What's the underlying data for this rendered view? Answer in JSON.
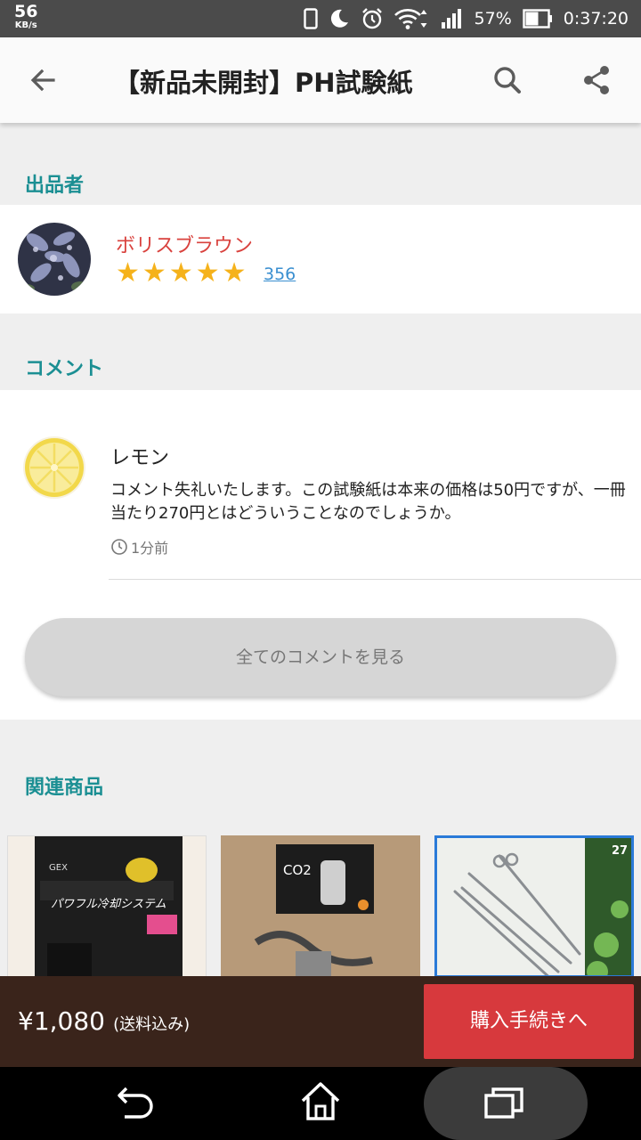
{
  "status_bar": {
    "speed_value": "56",
    "speed_unit": "KB/s",
    "battery": "57%",
    "time": "0:37:20",
    "icons": [
      "phone-icon",
      "moon-icon",
      "alarm-icon",
      "wifi-icon",
      "signal-icon",
      "battery-icon"
    ]
  },
  "appbar": {
    "title": "【新品未開封】PH試験紙",
    "icons": [
      "back-arrow-icon",
      "search-icon",
      "share-icon"
    ]
  },
  "seller_section": {
    "heading": "出品者",
    "name": "ボリスブラウン",
    "stars": "★★★★★",
    "rating_out_of_5": 5,
    "rating_count": "356"
  },
  "comment_section": {
    "heading": "コメント",
    "comment": {
      "user": "レモン",
      "text": "コメント失礼いたします。この試験紙は本来の価格は50円ですが、一冊当たり270円とはどういうことなのでしょうか。",
      "time": "1分前"
    },
    "all_button": "全てのコメントを見る"
  },
  "related_section": {
    "heading": "関連商品",
    "product_images": [
      "aquarium-cooler-photo",
      "co2-regulator-photo",
      "tweezers-photo"
    ]
  },
  "bottom_bar": {
    "price": "¥1,080",
    "shipping": "(送料込み)",
    "buy_button": "購入手続きへ"
  },
  "nav_bar": {
    "icons": [
      "back-nav-icon",
      "home-nav-icon",
      "recent-apps-icon"
    ]
  }
}
